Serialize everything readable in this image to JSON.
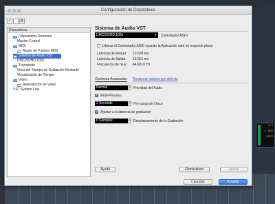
{
  "dialog": {
    "title": "Configuración de Dispositivos"
  },
  "toolbar": {
    "add_label": "+",
    "remove_label": "−",
    "reset_label": "⊞"
  },
  "tree": {
    "header": "Dispositivos",
    "items": [
      {
        "label": "Dispositivos Remotos",
        "icon": "folder-icon"
      },
      {
        "label": "Mackie Control",
        "icon": "doc-icon"
      },
      {
        "label": "MIDI",
        "icon": "folder-icon"
      },
      {
        "label": "Ajuste de Puertos MIDI",
        "icon": "doc-icon"
      },
      {
        "label": "Sistema de Audio VST",
        "icon": "doc-icon",
        "selected": true
      },
      {
        "label": "UMC202HD 192k",
        "icon": "none"
      },
      {
        "label": "Transporte",
        "icon": "folder-icon"
      },
      {
        "label": "Visor del Tiempo de Grabación Restante",
        "icon": "none"
      },
      {
        "label": "Visualización de Tiempo",
        "icon": "none"
      },
      {
        "label": "Video",
        "icon": "folder-icon"
      },
      {
        "label": "Reproductor de Video",
        "icon": "doc-icon"
      },
      {
        "label": "VST System Link",
        "icon": "none"
      }
    ]
  },
  "panel": {
    "title": "Sistema de Audio VST",
    "driver_value": "UMC202HD 192k",
    "driver_label": "Controlador ASIO",
    "release_label": "Liberar el Controlador ASIO cuando la Aplicación esté en segundo plano",
    "release_checked": false,
    "latency_in_label": "Latencia de Entrad",
    "latency_in_value": "13.878 ms",
    "latency_out_label": "Latencia de Salida:",
    "latency_out_value": "13.651 ms",
    "sample_rate_label": "Frecuencia de mue",
    "sample_rate_value": "44100.0 Hz",
    "tab_advanced": "Opciones Avanzadas",
    "tab_restore": "Restaurar valores por defecto",
    "priority_value": "Normal",
    "priority_label": "Prioridad del Audio",
    "multiprocess_label": "Multi-Proceso",
    "multiprocess_checked": true,
    "preload_value": "2 Seconds",
    "preload_label": "Pre-carga de Disco",
    "adjust_label": "Ajustar a la latencia de grabación",
    "adjust_checked": true,
    "shift_value": "0 Samples",
    "shift_label": "Desplazamiento de la Grabación"
  },
  "buttons": {
    "help": "Ayuda",
    "reset": "Reinicializar",
    "apply": "Aplicar",
    "cancel": "Cancelar",
    "accept": "Aceptar"
  },
  "background": {
    "meter_top": "4/4",
    "meter_mid": "1.000",
    "meter_bot": "ENTR"
  },
  "colors": {
    "selection": "#3a6fd8",
    "primary_button": "#2f78e6"
  }
}
